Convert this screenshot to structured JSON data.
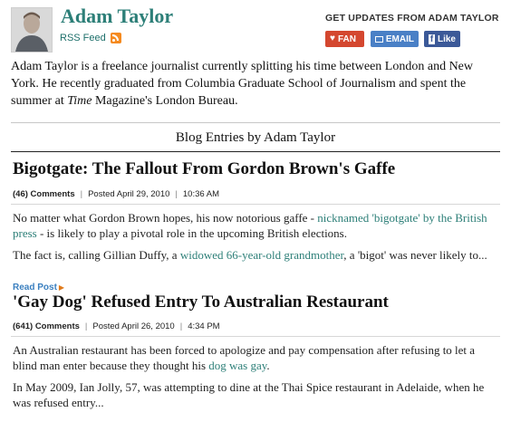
{
  "author": {
    "name": "Adam Taylor",
    "rss_label": "RSS Feed",
    "bio_before": "Adam Taylor is a freelance journalist currently splitting his time between London and New York. He recently graduated from Columbia Graduate School of Journalism and spent the summer at ",
    "bio_italic": "Time",
    "bio_after": " Magazine's London Bureau."
  },
  "updates": {
    "heading": "GET UPDATES FROM ADAM TAYLOR",
    "fan_label": "FAN",
    "email_label": "EMAIL",
    "like_label": "Like"
  },
  "section_title": "Blog Entries by Adam Taylor",
  "posts": [
    {
      "title": "Bigotgate: The Fallout From Gordon Brown's Gaffe",
      "comments": "(46) Comments",
      "posted": "Posted April 29, 2010",
      "time": "10:36 AM",
      "p1_before": "No matter what Gordon Brown hopes, his now notorious gaffe - ",
      "p1_link": "nicknamed 'bigotgate' by the British press",
      "p1_after": " - is likely to play a pivotal role in the upcoming British elections.",
      "p2_before": "The fact is, calling Gillian Duffy, a ",
      "p2_link": "widowed 66-year-old grandmother",
      "p2_after": ", a 'bigot' was never likely to...",
      "read_more": "Read Post"
    },
    {
      "title": "'Gay Dog' Refused Entry To Australian Restaurant",
      "comments": "(641) Comments",
      "posted": "Posted April 26, 2010",
      "time": "4:34 PM",
      "p1_before": "An Australian restaurant has been forced to apologize and pay compensation after refusing to let a blind man enter because they thought his ",
      "p1_link": "dog was gay",
      "p1_after": ".",
      "p2": "In May 2009, Ian Jolly, 57, was attempting to dine at the Thai Spice restaurant in Adelaide, when he was refused entry..."
    }
  ],
  "colors": {
    "name": "#2d7f78",
    "link": "#2d7f78",
    "fan": "#d4472f",
    "email": "#4a80c6",
    "like": "#3b5998",
    "rss": "#f58a1f"
  }
}
